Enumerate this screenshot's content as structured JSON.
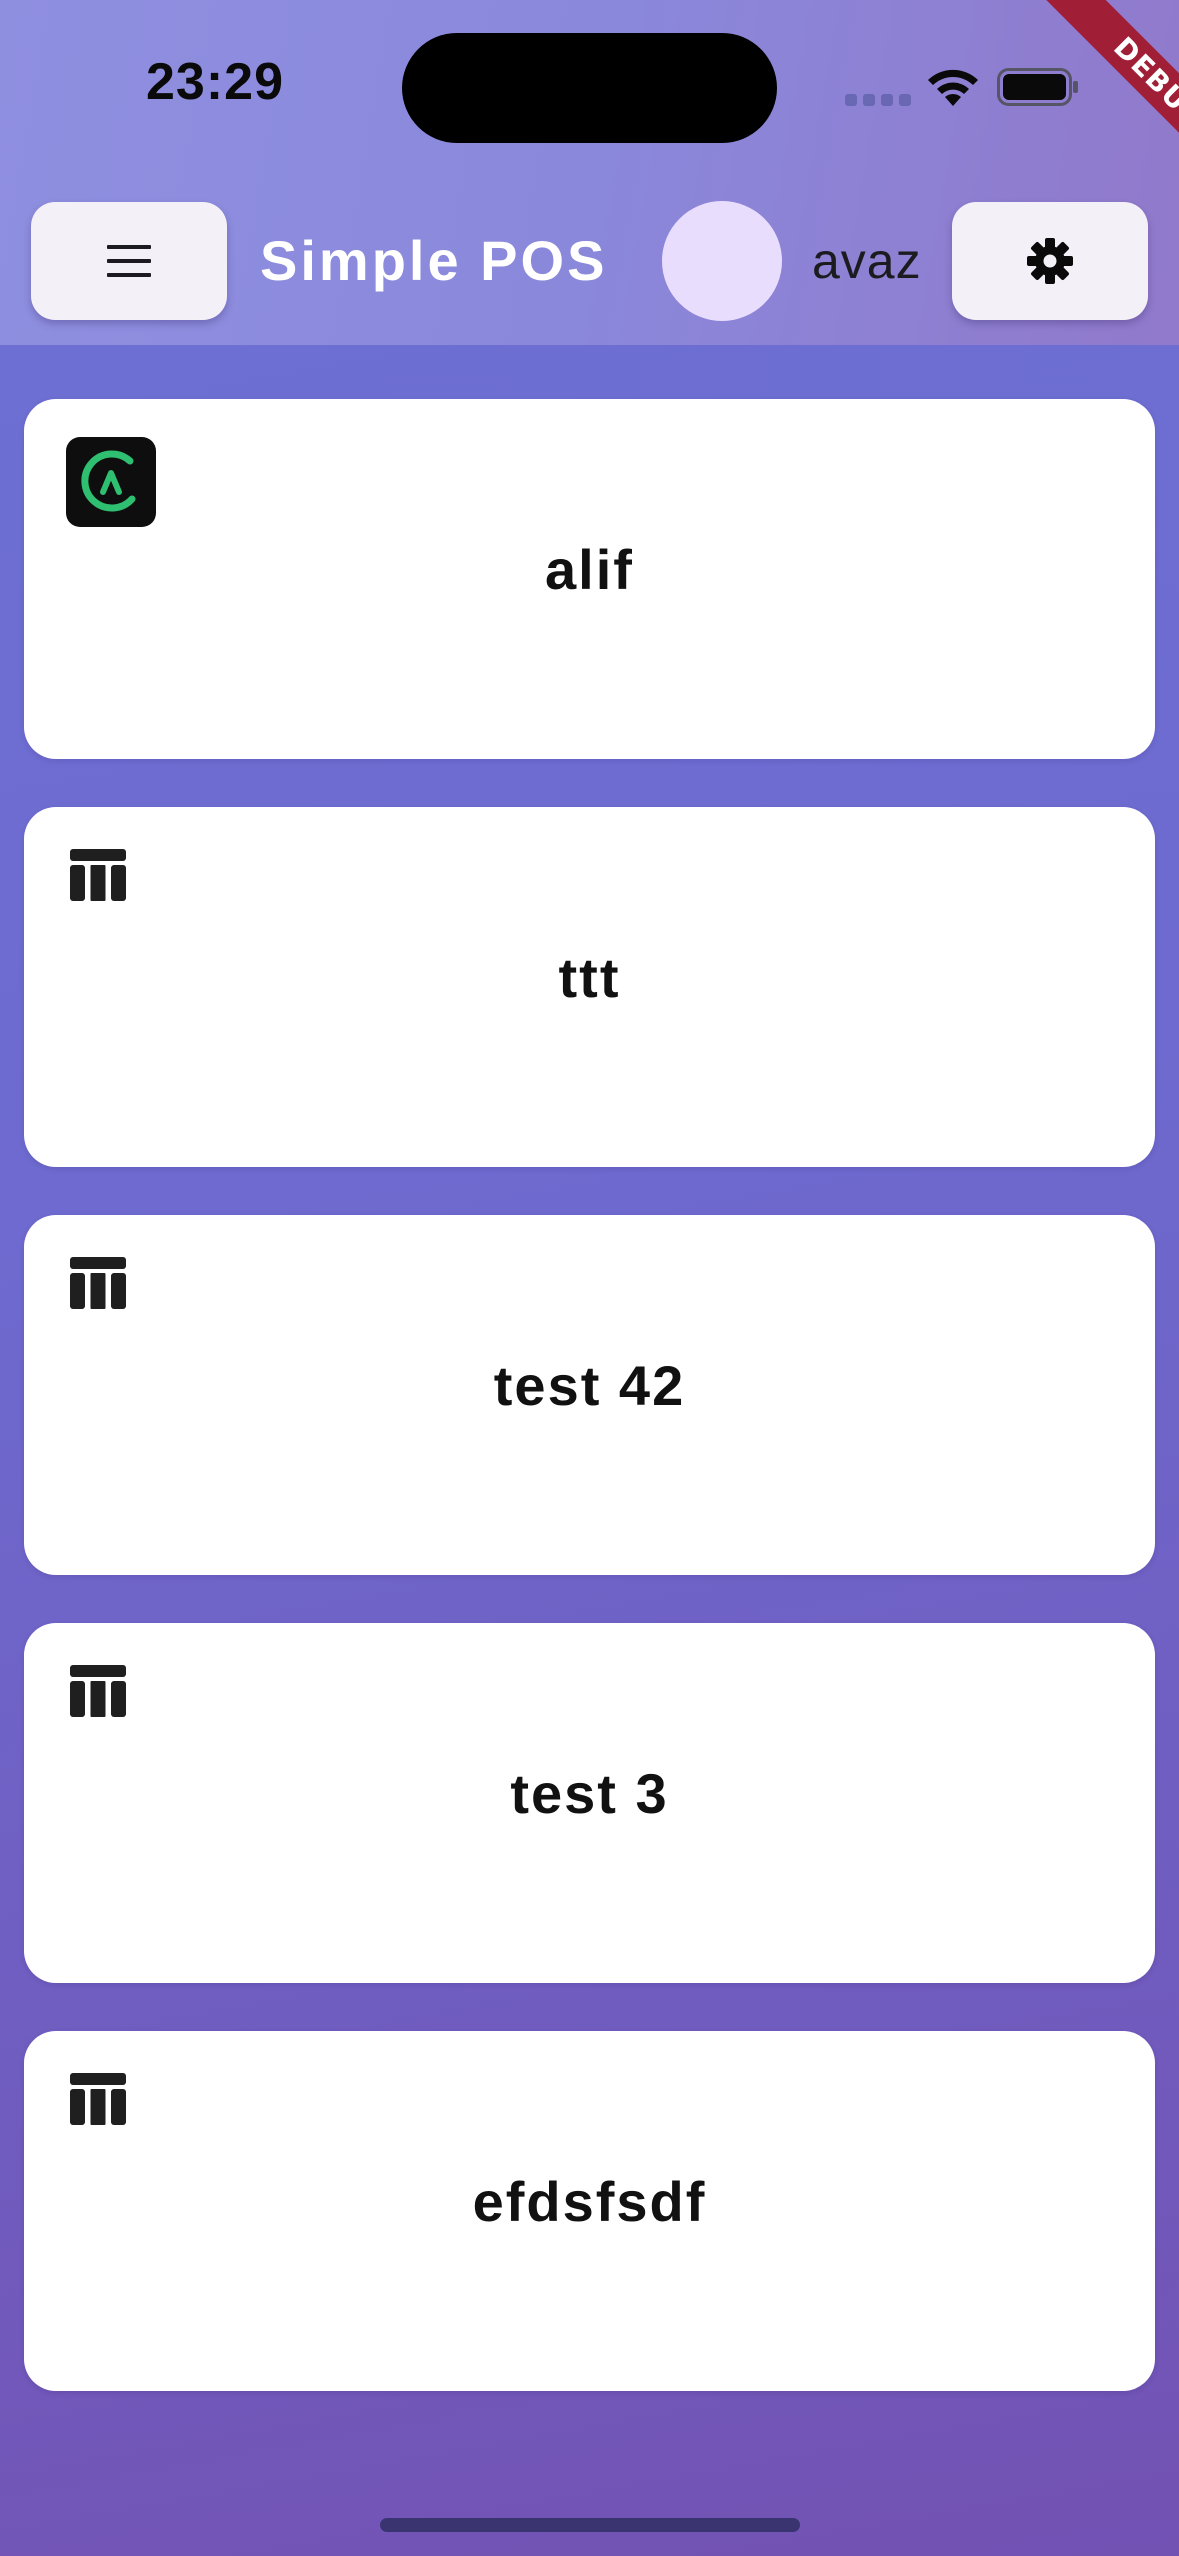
{
  "status_bar": {
    "time": "23:29"
  },
  "debug_banner": "DEBUG",
  "app_bar": {
    "title": "Simple POS",
    "user_name": "avaz",
    "menu_icon": "menu-icon",
    "settings_icon": "gear-icon"
  },
  "cards": [
    {
      "label": "alif",
      "icon": "alif-logo-icon"
    },
    {
      "label": "ttt",
      "icon": "table-icon"
    },
    {
      "label": "test 42",
      "icon": "table-icon"
    },
    {
      "label": "test 3",
      "icon": "table-icon"
    },
    {
      "label": "efdsfsdf",
      "icon": "table-icon"
    }
  ],
  "colors": {
    "background": "#6e6acf",
    "header": "#8d8ade",
    "card": "#ffffff",
    "button": "#f4f0f8",
    "avatar": "#e9ddfd",
    "debug": "#a01e36",
    "logo_accent": "#2fbf71"
  }
}
